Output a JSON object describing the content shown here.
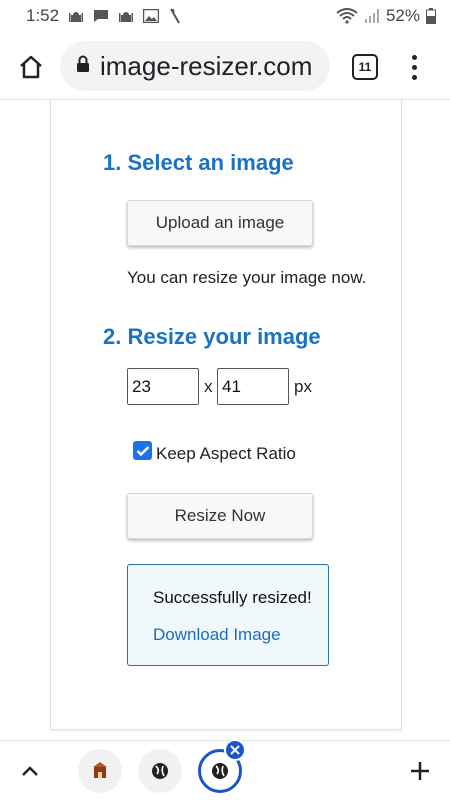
{
  "status_bar": {
    "time": "1:52",
    "battery_percent": "52%",
    "notification_icons": [
      "mosque-icon",
      "chat-icon",
      "mosque-icon",
      "image-icon",
      "stylus-icon"
    ]
  },
  "browser": {
    "url": "image-resizer.com",
    "tab_count": "11"
  },
  "page": {
    "section1_title": "1. Select an image",
    "upload_button": "Upload an image",
    "upload_note": "You can resize your image now.",
    "section2_title": "2. Resize your image",
    "width_value": "23",
    "height_value": "41",
    "times_sign": "x",
    "unit": "px",
    "keep_aspect_label": "Keep Aspect Ratio",
    "keep_aspect_checked": true,
    "resize_button": "Resize Now",
    "success_message": "Successfully resized!",
    "download_link": "Download Image"
  },
  "colors": {
    "heading_blue": "#1a73c2",
    "link_blue": "#1a6ec2",
    "checkbox_blue": "#1a73e8",
    "active_tab_blue": "#1a56c9"
  }
}
